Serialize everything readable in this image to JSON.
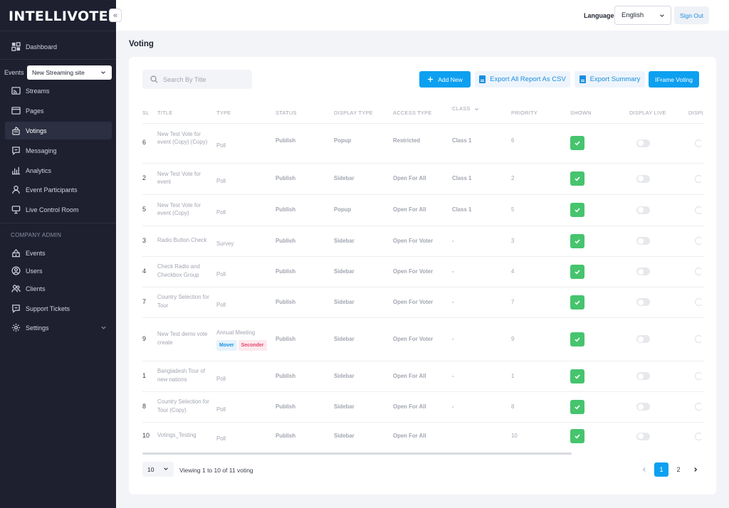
{
  "app": {
    "logo": "INTELLIVOTES",
    "collapse_glyph": "«"
  },
  "sidebar": {
    "top_items": [
      {
        "label": "Dashboard",
        "icon": "dashboard-icon"
      }
    ],
    "events_label": "Events",
    "events_selected": "New Streaming site",
    "event_items": [
      {
        "label": "Streams",
        "icon": "stream-icon"
      },
      {
        "label": "Pages",
        "icon": "pages-icon"
      },
      {
        "label": "Votings",
        "icon": "voting-icon",
        "active": true
      },
      {
        "label": "Messaging",
        "icon": "message-icon"
      },
      {
        "label": "Analytics",
        "icon": "analytics-icon"
      },
      {
        "label": "Event Participants",
        "icon": "user-icon"
      },
      {
        "label": "Live Control Room",
        "icon": "presentation-icon"
      }
    ],
    "admin_section": "COMPANY ADMIN",
    "admin_items": [
      {
        "label": "Events",
        "icon": "events-icon"
      },
      {
        "label": "Users",
        "icon": "users-icon"
      },
      {
        "label": "Clients",
        "icon": "clients-icon"
      },
      {
        "label": "Support Tickets",
        "icon": "ticket-icon"
      },
      {
        "label": "Settings",
        "icon": "gear-icon"
      }
    ]
  },
  "topbar": {
    "language_label": "Language",
    "language_value": "English",
    "signout_label": "Sign Out"
  },
  "page": {
    "title": "Voting",
    "search_placeholder": "Search By Title",
    "buttons": {
      "add_new": "Add New",
      "export_csv": "Export All Report As CSV",
      "export_summary": "Export Summary",
      "iframe": "IFrame Voting"
    }
  },
  "table": {
    "headers": {
      "sl": "SL",
      "title": "TITLE",
      "type": "TYPE",
      "status": "STATUS",
      "display_type": "DISPLAY TYPE",
      "access_type": "ACCESS TYPE",
      "class": "CLASS",
      "priority": "PRIORITY",
      "shown": "SHOWN",
      "display_live": "DISPLAY LIVE",
      "display_cut": "DISPL"
    },
    "rows": [
      {
        "sl": "6",
        "title": "New Test Vote for event (Copy) (Copy)",
        "type": "Poll",
        "status": "Publish",
        "display": "Popup",
        "access": "Restricted",
        "class": "Class 1",
        "priority": "6",
        "shown": true,
        "live": false
      },
      {
        "sl": "2",
        "title": "New Test Vote for event",
        "type": "Poll",
        "status": "Publish",
        "display": "Sidebar",
        "access": "Open For All",
        "class": "Class 1",
        "priority": "2",
        "shown": true,
        "live": false
      },
      {
        "sl": "5",
        "title": "New Test Vote for event (Copy)",
        "type": "Poll",
        "status": "Publish",
        "display": "Popup",
        "access": "Open For All",
        "class": "Class 1",
        "priority": "5",
        "shown": true,
        "live": false
      },
      {
        "sl": "3",
        "title": "Radio Button Check",
        "type": "Survey",
        "status": "Publish",
        "display": "Sidebar",
        "access": "Open For Voter",
        "class": "-",
        "priority": "3",
        "shown": true,
        "live": false
      },
      {
        "sl": "4",
        "title": "Check Radio and Checkbox Group",
        "type": "Poll",
        "status": "Publish",
        "display": "Sidebar",
        "access": "Open For Voter",
        "class": "-",
        "priority": "4",
        "shown": true,
        "live": false
      },
      {
        "sl": "7",
        "title": "Country Selection for Tour",
        "type": "Poll",
        "status": "Publish",
        "display": "Sidebar",
        "access": "Open For Voter",
        "class": "-",
        "priority": "7",
        "shown": true,
        "live": false
      },
      {
        "sl": "9",
        "title": "New Test demo vote create",
        "type": "Annual Meeting",
        "tags": [
          "Mover",
          "Seconder"
        ],
        "status": "Publish",
        "display": "Sidebar",
        "access": "Open For Voter",
        "class": "-",
        "priority": "9",
        "shown": true,
        "live": false
      },
      {
        "sl": "1",
        "title": "Bangladesh Tour of new nations",
        "type": "Poll",
        "status": "Publish",
        "display": "Sidebar",
        "access": "Open For All",
        "class": "-",
        "priority": "1",
        "shown": true,
        "live": false
      },
      {
        "sl": "8",
        "title": "Country Selection for Tour (Copy)",
        "type": "Poll",
        "status": "Publish",
        "display": "Sidebar",
        "access": "Open For All",
        "class": "-",
        "priority": "8",
        "shown": true,
        "live": false
      },
      {
        "sl": "10",
        "title": "Votings_Testing",
        "type": "Poll",
        "status": "Publish",
        "display": "Sidebar",
        "access": "Open For All",
        "class": "",
        "priority": "10",
        "shown": true,
        "live": false
      }
    ]
  },
  "footer": {
    "per_page": "10",
    "viewing_text": "Viewing 1 to 10 of 11 voting",
    "pages": [
      "1",
      "2"
    ],
    "current_page": "1"
  },
  "colors": {
    "sidebar_bg": "#1e2030",
    "accent": "#0ea0f0",
    "shown_green": "#46c46e",
    "mover": "#1a8fe0",
    "seconder": "#e4476d"
  }
}
